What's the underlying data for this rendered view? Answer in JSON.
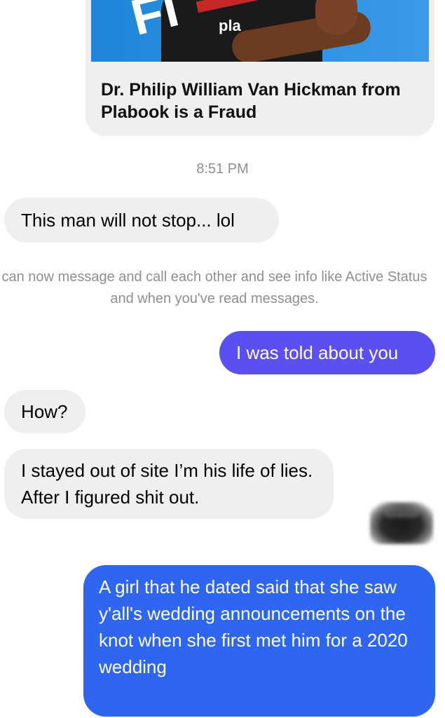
{
  "shared_link": {
    "image_letters": "FI",
    "image_logo": "pla",
    "title": "Dr. Philip William Van Hickman from Plabook is a Fraud"
  },
  "timestamp": "8:51 PM",
  "messages": [
    {
      "direction": "incoming",
      "text": "This man will not stop... lol"
    },
    {
      "direction": "outgoing",
      "text": "I was told about you",
      "color": "#5b4ff0"
    },
    {
      "direction": "incoming",
      "text": "How?"
    },
    {
      "direction": "incoming",
      "text": "I stayed out of site I’m his life of lies. After I figured shit out."
    },
    {
      "direction": "outgoing",
      "text": "A girl that he dated said that she saw y'all's wedding announcements on the knot when she first met him for a 2020 wedding",
      "color": "#2f66ef"
    }
  ],
  "system_note": "can now message and call each other and see info like Active Status and when you've read messages.",
  "colors": {
    "incoming_bubble": "#efefef",
    "outgoing_bubble_top": "#5b4ff0",
    "outgoing_bubble_bottom": "#2f66ef",
    "meta_text": "#8e8e93"
  }
}
